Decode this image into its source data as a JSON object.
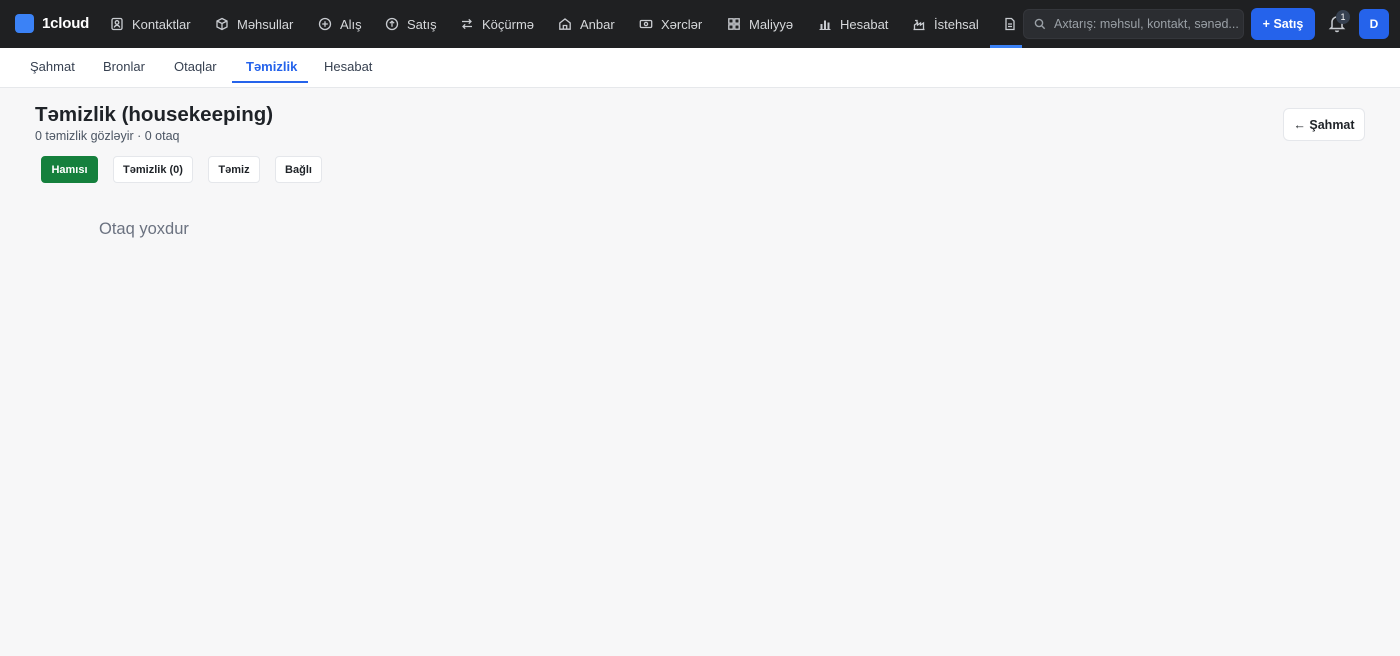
{
  "app": {
    "name": "1cloud"
  },
  "nav": {
    "items": [
      {
        "label": "Kontaktlar",
        "icon": "contacts-icon"
      },
      {
        "label": "Məhsullar",
        "icon": "box-icon"
      },
      {
        "label": "Alış",
        "icon": "circle-plus-icon"
      },
      {
        "label": "Satış",
        "icon": "circle-up-icon"
      },
      {
        "label": "Köçürmə",
        "icon": "transfer-icon"
      },
      {
        "label": "Anbar",
        "icon": "warehouse-icon"
      },
      {
        "label": "Xərclər",
        "icon": "cash-icon"
      },
      {
        "label": "Maliyyə",
        "icon": "grid-icon"
      },
      {
        "label": "Hesabat",
        "icon": "chart-icon"
      },
      {
        "label": "İstehsal",
        "icon": "factory-icon"
      }
    ],
    "active_icon": "document-icon",
    "search_placeholder": "Axtarış: məhsul, kontakt, sənəd...",
    "new_sale_label": "+ Satış",
    "notification_count": "1",
    "avatar_initial": "D"
  },
  "subnav": {
    "tabs": [
      {
        "label": "Şahmat"
      },
      {
        "label": "Bronlar"
      },
      {
        "label": "Otaqlar"
      },
      {
        "label": "Təmizlik",
        "active": true
      },
      {
        "label": "Hesabat"
      }
    ]
  },
  "page": {
    "title": "Təmizlik (housekeeping)",
    "subtitle": "0 təmizlik gözləyir · 0 otaq",
    "back_label": "← Şahmat",
    "filters": [
      {
        "label": "Hamısı",
        "active": true
      },
      {
        "label": "Təmizlik (0)"
      },
      {
        "label": "Təmiz"
      },
      {
        "label": "Bağlı"
      }
    ],
    "empty_text": "Otaq yoxdur"
  },
  "colors": {
    "topbar": "#1f2022",
    "accent": "#2563eb",
    "active_filter": "#15803d"
  }
}
